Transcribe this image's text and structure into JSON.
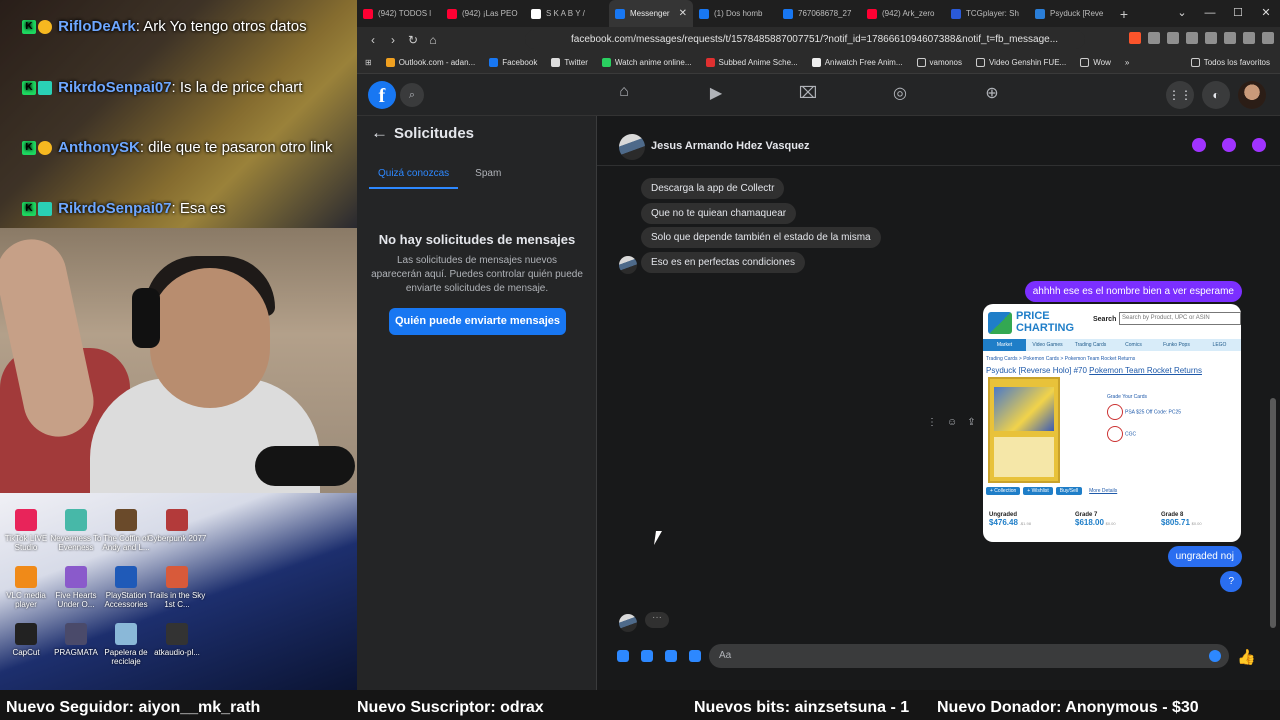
{
  "stream": {
    "chat": [
      {
        "user": "RifloDeArk",
        "text": ": Ark Yo tengo otros datos"
      },
      {
        "user": "RikrdoSenpai07",
        "text": ": Is la de price chart"
      },
      {
        "user": "AnthonySK",
        "text": ": dile que te pasaron otro link"
      },
      {
        "user": "RikrdoSenpai07",
        "text": ": Esa es"
      }
    ],
    "desktop_icons": [
      {
        "label": "TikTok LIVE Studio",
        "color": "#e8245a"
      },
      {
        "label": "Nevermess To Evenness",
        "color": "#47b8a8"
      },
      {
        "label": "The Coffin of Andy and L...",
        "color": "#6a4a2a"
      },
      {
        "label": "Cyberpunk 2077",
        "color": "#b33a3a"
      },
      {
        "label": "VLC media player",
        "color": "#f08a18"
      },
      {
        "label": "Five Hearts Under O...",
        "color": "#8a5acb"
      },
      {
        "label": "PlayStation Accessories",
        "color": "#1f5ab8"
      },
      {
        "label": "Trails in the Sky 1st C...",
        "color": "#d85a3a"
      },
      {
        "label": "CapCut",
        "color": "#222222"
      },
      {
        "label": "PRAGMATA",
        "color": "#4a4a6a"
      },
      {
        "label": "Papelera de reciclaje",
        "color": "#8ab8d8"
      },
      {
        "label": "atkaudio-pl...",
        "color": "#333333"
      }
    ],
    "ticker": {
      "follower": "Nuevo Seguidor: aiyon__mk_rath",
      "subscriber": "Nuevo Suscriptor: odrax",
      "bits": "Nuevos bits: ainzsetsuna - 1",
      "donor": "Nuevo Donador: Anonymous - $30"
    }
  },
  "browser": {
    "tabs": [
      {
        "label": "(942) TODOS l",
        "color": "#ff0033"
      },
      {
        "label": "(942) ¡Las PEO",
        "color": "#ff0033"
      },
      {
        "label": "S K A B Y /",
        "color": "#ffffff"
      },
      {
        "label": "Messenger",
        "color": "#1877f2",
        "active": true
      },
      {
        "label": "(1) Dos homb",
        "color": "#1877f2"
      },
      {
        "label": "767068678_27",
        "color": "#1877f2"
      },
      {
        "label": "(942) Ark_zero",
        "color": "#ff0033"
      },
      {
        "label": "TCGplayer: Sh",
        "color": "#2a5ad8"
      },
      {
        "label": "Psyduck [Reve",
        "color": "#2a7ed8"
      }
    ],
    "new_tab": "+",
    "url": "facebook.com/messages/requests/t/1578485887007751/?notif_id=1786661094607388&notif_t=fb_message...",
    "bookmarks": [
      {
        "label": "Outlook.com - adan...",
        "color": "#f0a020"
      },
      {
        "label": "Facebook",
        "color": "#1877f2"
      },
      {
        "label": "Twitter",
        "color": "#ffffff"
      },
      {
        "label": "Watch anime online...",
        "color": "#2ad060"
      },
      {
        "label": "Subbed Anime Sche...",
        "color": "#e03030"
      },
      {
        "label": "Aniwatch Free Anim...",
        "color": "#ffffff"
      },
      {
        "label": "vamonos",
        "color": "#cccccc"
      },
      {
        "label": "Video Genshin FUE...",
        "color": "#cccccc"
      },
      {
        "label": "Wow",
        "color": "#cccccc"
      }
    ],
    "bookmarks_more": "»",
    "all_bookmarks": "Todos los favoritos"
  },
  "facebook": {
    "logo": "f",
    "requests": {
      "title": "Solicitudes",
      "tabs": [
        "Quizá conozcas",
        "Spam"
      ],
      "empty_title": "No hay solicitudes de mensajes",
      "empty_text": "Las solicitudes de mensajes nuevos aparecerán aquí. Puedes controlar quién puede enviarte solicitudes de mensaje.",
      "button": "Quién puede enviarte mensajes"
    },
    "conversation": {
      "name": "Jesus Armando Hdez Vasquez",
      "incoming": [
        "Descarga la app de Collectr",
        "Que no te quiean chamaquear",
        "Solo que depende también el estado de la misma",
        "Eso es en perfectas condiciones"
      ],
      "outgoing": [
        "ahhhh ese es el nombre bien a ver esperame",
        "ungraded noj",
        "?"
      ],
      "typing": "···",
      "composer_placeholder": "Aa"
    },
    "price_card": {
      "logo_text": "PRICE CHARTING",
      "search_label": "Search",
      "search_placeholder": "Search by Product, UPC or ASIN",
      "nav": [
        "Market",
        "Video Games",
        "Trading Cards",
        "Comics",
        "Funko Pops",
        "LEGO"
      ],
      "breadcrumb": "Trading Cards > Pokemon Cards > Pokemon Team Rocket Returns",
      "title": "Psyduck [Reverse Holo] #70",
      "set": "Pokemon Team Rocket Returns",
      "grade_caption": "Grade Your Cards",
      "grade_1": "PSA",
      "grade_1_sub": "$25 Off Code: PC25",
      "grade_2": "CGC",
      "buttons": [
        "+ Collection",
        "+ Wishlist",
        "Buy/Sell",
        "More Details"
      ],
      "prices": [
        {
          "grade": "Ungraded",
          "value": "$476.48",
          "change": "-$1.98"
        },
        {
          "grade": "Grade 7",
          "value": "$618.00",
          "change": "$0.00"
        },
        {
          "grade": "Grade 8",
          "value": "$805.71",
          "change": "$0.00"
        }
      ]
    }
  }
}
